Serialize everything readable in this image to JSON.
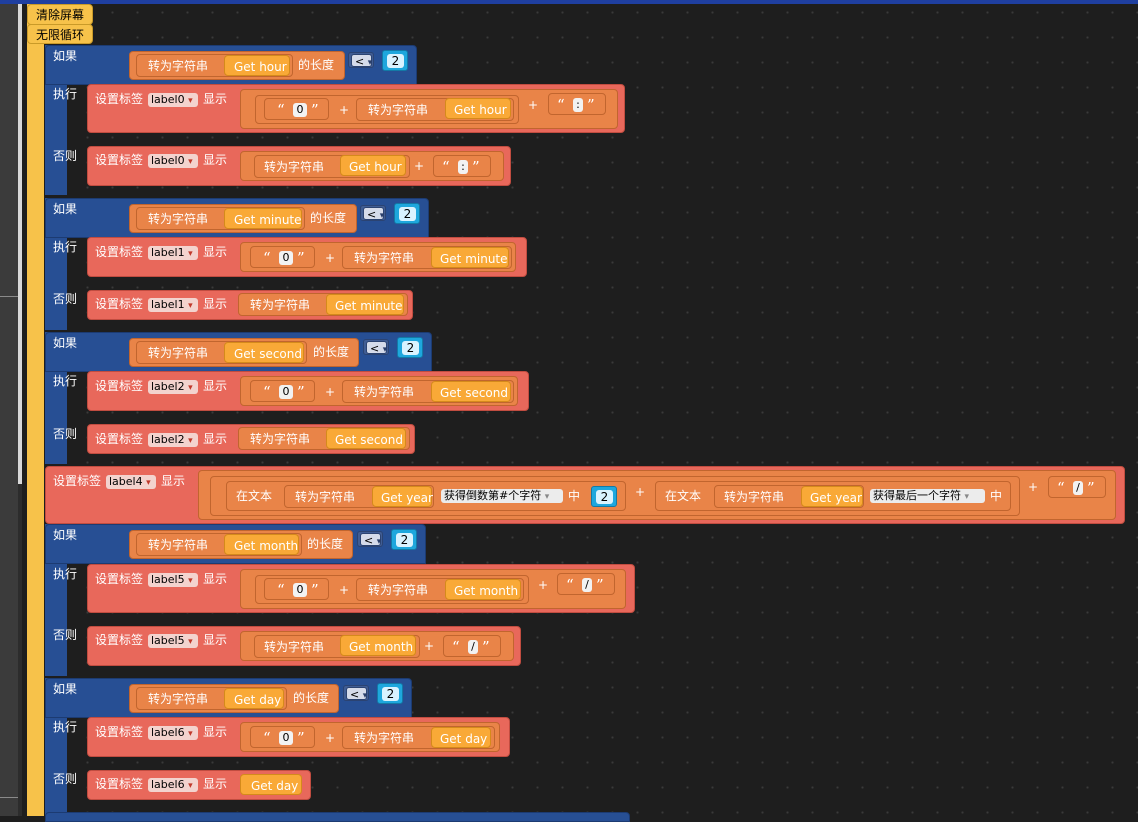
{
  "header": {
    "clear_screen": "清除屏幕",
    "forever_loop": "无限循环"
  },
  "keywords": {
    "if": "如果",
    "do": "执行",
    "else": "否则",
    "set_label": "设置标签",
    "show": "显示",
    "to_string": "转为字符串",
    "length_of": "的长度",
    "in_text": "在文本",
    "get_nth_from_end": "获得倒数第#个字符",
    "get_last_char": "获得最后一个字符",
    "zhong": "中",
    "plus": "+",
    "lt": "<",
    "quote_open": "“",
    "quote_close": "”",
    "dropdown_arrow": "▾"
  },
  "getters": {
    "hour": "Get hour",
    "minute": "Get minute",
    "second": "Get second",
    "year": "Get year",
    "month": "Get month",
    "day": "Get day"
  },
  "labels": {
    "l0": "label0",
    "l1": "label1",
    "l2": "label2",
    "l4": "label4",
    "l5": "label5",
    "l6": "label6"
  },
  "values": {
    "two": "2",
    "zero": "0",
    "colon": ":",
    "slash": "/"
  },
  "colors": {
    "event": "#f7c24a",
    "control": "#274f94",
    "set_label": "#e8685b",
    "text": "#e98448",
    "function": "#f9a937",
    "compare": "#405d94",
    "number": "#1ea7dd"
  }
}
